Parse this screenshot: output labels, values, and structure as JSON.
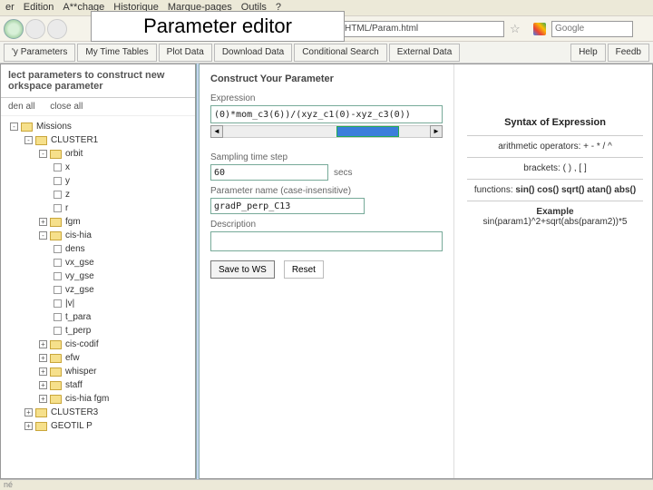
{
  "menu": {
    "items": [
      "er",
      "Edition",
      "A**chage",
      "Historique",
      "Marque-pages",
      "Outils",
      "?"
    ]
  },
  "title_overlay": "Parameter editor",
  "nav": {
    "url": "HTML/Param.html",
    "search_placeholder": "Google"
  },
  "toolbar": {
    "tabs": [
      "'y Parameters",
      "My Time Tables",
      "Plot Data",
      "Download Data",
      "Conditional Search",
      "External Data"
    ],
    "right": [
      "Help",
      "Feedb"
    ]
  },
  "sidebar": {
    "heading": "lect parameters to construct new\norkspace parameter",
    "controls": {
      "open": "den all",
      "close": "close all"
    },
    "tree": [
      {
        "l": 0,
        "box": "-",
        "type": "m",
        "label": "Missions"
      },
      {
        "l": 1,
        "box": "-",
        "type": "m",
        "label": "CLUSTER1"
      },
      {
        "l": 2,
        "box": "-",
        "type": "c",
        "label": "orbit"
      },
      {
        "l": 3,
        "box": "",
        "type": "leaf",
        "label": "x"
      },
      {
        "l": 3,
        "box": "",
        "type": "leaf",
        "label": "y"
      },
      {
        "l": 3,
        "box": "",
        "type": "leaf",
        "label": "z"
      },
      {
        "l": 3,
        "box": "",
        "type": "leaf",
        "label": "r"
      },
      {
        "l": 2,
        "box": "+",
        "type": "c",
        "label": "fgm"
      },
      {
        "l": 2,
        "box": "-",
        "type": "c",
        "label": "cis-hia"
      },
      {
        "l": 3,
        "box": "",
        "type": "leaf",
        "label": "dens"
      },
      {
        "l": 3,
        "box": "",
        "type": "leaf",
        "label": "vx_gse"
      },
      {
        "l": 3,
        "box": "",
        "type": "leaf",
        "label": "vy_gse"
      },
      {
        "l": 3,
        "box": "",
        "type": "leaf",
        "label": "vz_gse"
      },
      {
        "l": 3,
        "box": "",
        "type": "leaf",
        "label": "|v|"
      },
      {
        "l": 3,
        "box": "",
        "type": "leaf",
        "label": "t_para"
      },
      {
        "l": 3,
        "box": "",
        "type": "leaf",
        "label": "t_perp"
      },
      {
        "l": 2,
        "box": "+",
        "type": "c",
        "label": "cis-codif"
      },
      {
        "l": 2,
        "box": "+",
        "type": "c",
        "label": "efw"
      },
      {
        "l": 2,
        "box": "+",
        "type": "c",
        "label": "whisper"
      },
      {
        "l": 2,
        "box": "+",
        "type": "c",
        "label": "staff"
      },
      {
        "l": 2,
        "box": "+",
        "type": "c",
        "label": "cis-hia fgm"
      },
      {
        "l": 1,
        "box": "+",
        "type": "m",
        "label": "CLUSTER3"
      },
      {
        "l": 1,
        "box": "+",
        "type": "m",
        "label": "GEOTIL P"
      }
    ]
  },
  "form": {
    "title": "Construct Your Parameter",
    "expr_label": "Expression",
    "expr_value": "(0)*mom_c3(6))/(xyz_c1(0)-xyz_c3(0))",
    "step_label": "Sampling time step",
    "step_value": "60",
    "step_unit": "secs",
    "name_label": "Parameter name (case-insensitive)",
    "name_value": "gradP_perp_C13",
    "desc_label": "Description",
    "desc_value": "",
    "save": "Save to WS",
    "reset": "Reset"
  },
  "syntax": {
    "heading": "Syntax of Expression",
    "ops": "arithmetic operators: + - * / ^",
    "brackets": "brackets: ( ) , [ ]",
    "funcs_label": "functions:",
    "funcs": "sin() cos() sqrt() atan() abs()",
    "example_label": "Example",
    "example": "sin(param1)^2+sqrt(abs(param2))*5"
  },
  "status": "né"
}
